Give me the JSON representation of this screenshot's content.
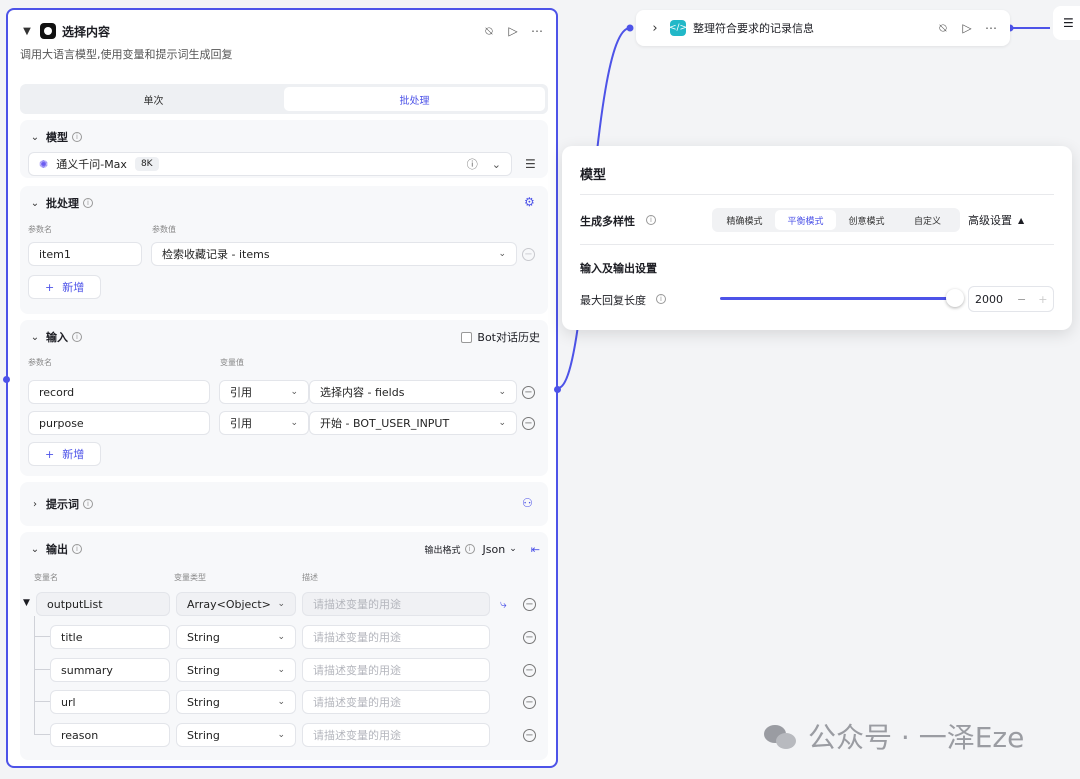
{
  "node": {
    "title": "选择内容",
    "description": "调用大语言模型,使用变量和提示词生成回复",
    "tabs": [
      "单次",
      "批处理"
    ]
  },
  "model_section": {
    "title": "模型",
    "model_name": "通义千问-Max",
    "context_tag": "8K"
  },
  "batch_section": {
    "title": "批处理",
    "param_name_label": "参数名",
    "param_value_label": "参数值",
    "param_name": "item1",
    "param_value": "检索收藏记录 - items",
    "add_label": "新增"
  },
  "input_section": {
    "title": "输入",
    "history_label": "Bot对话历史",
    "param_name_label": "参数名",
    "var_value_label": "变量值",
    "rows": [
      {
        "name": "record",
        "type": "引用",
        "value": "选择内容 - fields"
      },
      {
        "name": "purpose",
        "type": "引用",
        "value": "开始 - BOT_USER_INPUT"
      }
    ],
    "add_label": "新增"
  },
  "prompt_section": {
    "title": "提示词"
  },
  "output_section": {
    "title": "输出",
    "format_label": "输出格式",
    "format_value": "Json",
    "col_name": "变量名",
    "col_type": "变量类型",
    "col_desc": "描述",
    "root": {
      "name": "outputList",
      "type": "Array<Object>",
      "desc_placeholder": "请描述变量的用途"
    },
    "children": [
      {
        "name": "title",
        "type": "String",
        "desc_placeholder": "请描述变量的用途"
      },
      {
        "name": "summary",
        "type": "String",
        "desc_placeholder": "请描述变量的用途"
      },
      {
        "name": "url",
        "type": "String",
        "desc_placeholder": "请描述变量的用途"
      },
      {
        "name": "reason",
        "type": "String",
        "desc_placeholder": "请描述变量的用途"
      }
    ]
  },
  "node2": {
    "title": "整理符合要求的记录信息"
  },
  "popup": {
    "title": "模型",
    "diversity_label": "生成多样性",
    "modes": [
      "精确模式",
      "平衡模式",
      "创意模式",
      "自定义"
    ],
    "active_mode": "平衡模式",
    "advanced_label": "高级设置",
    "io_label": "输入及输出设置",
    "max_len_label": "最大回复长度",
    "max_len_value": "2000",
    "slider_fraction": 0.96
  },
  "watermark": {
    "text": "公众号 · 一泽Eze"
  },
  "colors": {
    "accent": "#4d53e8",
    "canvas": "#f3f4f6"
  }
}
